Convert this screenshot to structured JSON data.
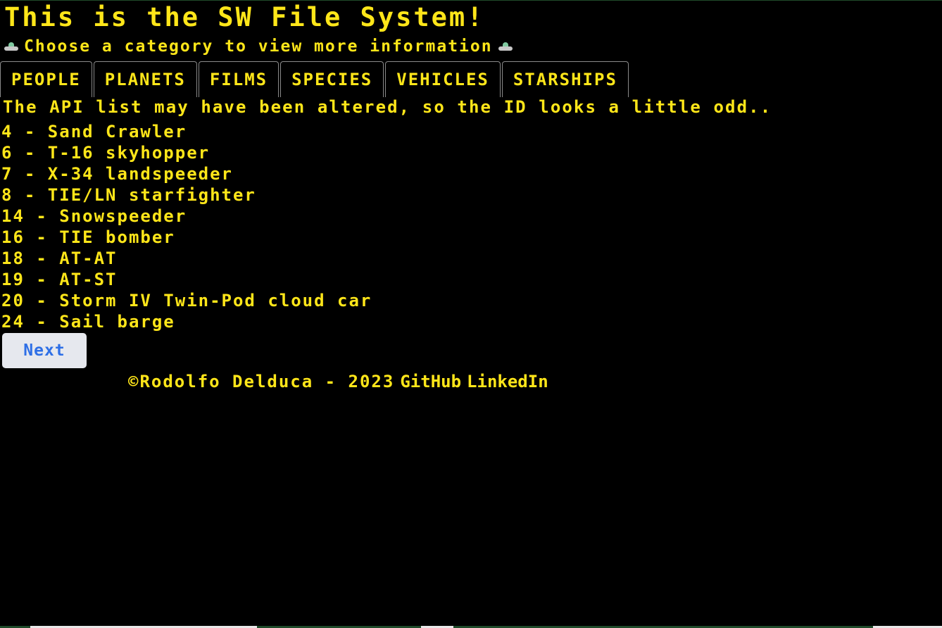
{
  "header": {
    "title": "This is the SW File System!",
    "subtitle": "Choose a category to view more information",
    "subtitle_icon": "ufo-icon"
  },
  "tabs": [
    {
      "label": "PEOPLE"
    },
    {
      "label": "PLANETS"
    },
    {
      "label": "FILMS"
    },
    {
      "label": "SPECIES"
    },
    {
      "label": "VEHICLES"
    },
    {
      "label": "STARSHIPS"
    }
  ],
  "notice": "The API list may have been altered, so the ID looks a little odd..",
  "items": [
    {
      "text": "4 - Sand Crawler"
    },
    {
      "text": "6 - T-16 skyhopper"
    },
    {
      "text": "7 - X-34 landspeeder"
    },
    {
      "text": "8 - TIE/LN starfighter"
    },
    {
      "text": "14 - Snowspeeder"
    },
    {
      "text": "16 - TIE bomber"
    },
    {
      "text": "18 - AT-AT"
    },
    {
      "text": "19 - AT-ST"
    },
    {
      "text": "20 - Storm IV Twin-Pod cloud car"
    },
    {
      "text": "24 - Sail barge"
    }
  ],
  "pagination": {
    "next_label": "Next"
  },
  "footer": {
    "copyright": "©Rodolfo Delduca - 2023",
    "github": "GitHub",
    "linkedin": "LinkedIn"
  },
  "colors": {
    "background": "#000000",
    "text": "#ffe619",
    "button_bg": "#e6e8ee",
    "button_text": "#2e6fe6"
  }
}
